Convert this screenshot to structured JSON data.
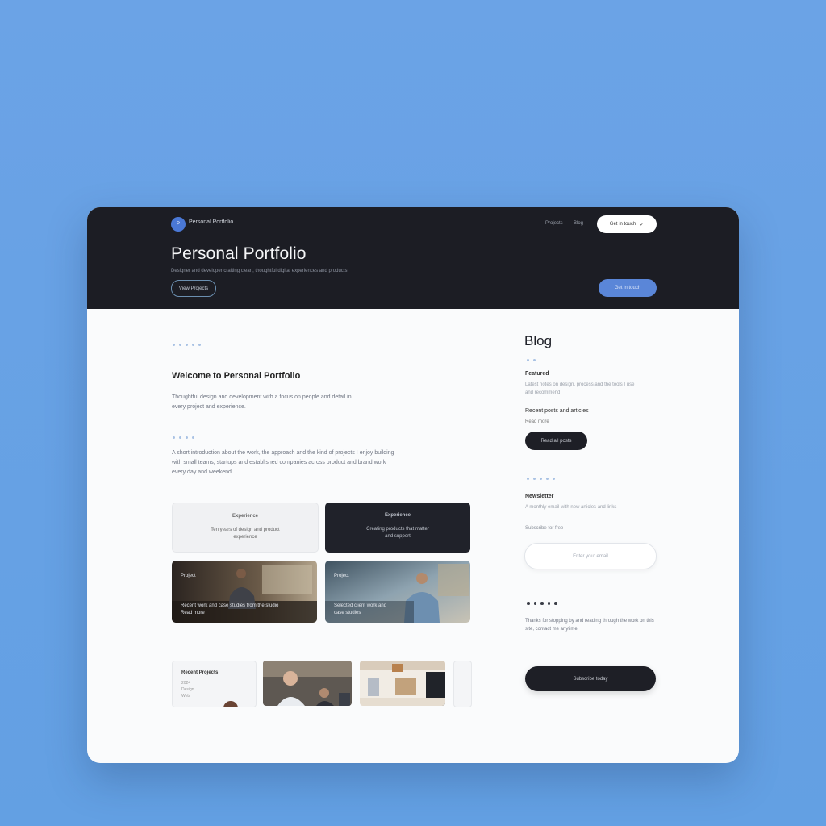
{
  "header": {
    "brand_icon": "P",
    "brand_name": "Personal Portfolio",
    "nav": [
      "Projects",
      "Blog"
    ],
    "contact_button": "Get in touch",
    "title": "Personal Portfolio",
    "subtitle": "Designer and developer crafting clean, thoughtful digital experiences and products",
    "secondary_button": "View Projects",
    "primary_button": "Get in touch"
  },
  "main": {
    "section_title": "Welcome to Personal Portfolio",
    "intro": [
      "Thoughtful design and development with a focus on people and detail in",
      "every project and experience."
    ],
    "body": [
      "A short introduction about the work, the approach and the kind of projects I enjoy building",
      "with small teams, startups and established companies across product and brand work",
      "every day and weekend."
    ],
    "cards": [
      {
        "title": "Experience",
        "body": [
          "Ten years of design and product",
          "experience"
        ]
      },
      {
        "title": "Experience",
        "body": [
          "Creating products that matter",
          "and support"
        ]
      }
    ],
    "photo_cards": [
      {
        "label": "Project",
        "caption": [
          "Recent work and case studies from the studio",
          "Read more"
        ]
      },
      {
        "label": "Project",
        "caption": [
          "Selected client work and",
          "case studies"
        ]
      }
    ],
    "thumbs": {
      "first_title": "Recent Projects",
      "first_lines": [
        "2024",
        "Design",
        "Web"
      ]
    }
  },
  "sidebar": {
    "title": "Blog",
    "post1_head": "Featured",
    "post1_body": [
      "Latest notes on design, process and the tools I use",
      "and recommend"
    ],
    "post2_head": "Recent posts and articles",
    "post2_sub": "Read more",
    "post2_button": "Read all posts",
    "newsletter_head": "Newsletter",
    "newsletter_body": "A monthly email with new articles and links",
    "email_label": "Subscribe for free",
    "email_placeholder": "Enter your email",
    "footer_text": [
      "Thanks for stopping by and reading through the work on this",
      "site, contact me anytime"
    ],
    "cta_button": "Subscribe today"
  },
  "colors": {
    "hero_bg": "#1c1d24",
    "accent": "#5a86d8",
    "page_bg": "#63a0e3"
  }
}
